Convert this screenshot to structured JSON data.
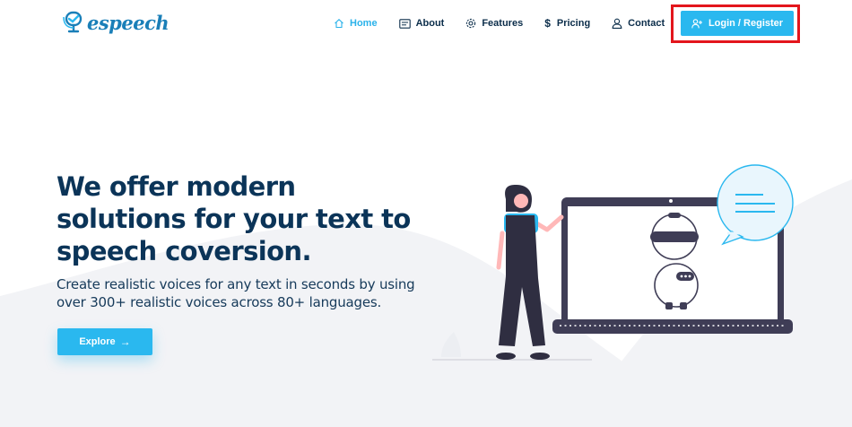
{
  "brand": {
    "name": "espeech"
  },
  "nav": {
    "items": [
      {
        "label": "Home",
        "icon": "home-icon",
        "active": true
      },
      {
        "label": "About",
        "icon": "about-card-icon"
      },
      {
        "label": "Features",
        "icon": "gear-icon"
      },
      {
        "label": "Pricing",
        "icon": "dollar-icon"
      },
      {
        "label": "Contact",
        "icon": "user-icon"
      }
    ],
    "login_label": "Login / Register"
  },
  "hero": {
    "title": "We offer modern solutions for your text to speech coversion.",
    "subtitle": "Create realistic voices for any text in seconds by using over 300+ realistic voices across 80+ languages.",
    "cta_label": "Explore",
    "cta_icon": "arrow-right-icon"
  },
  "colors": {
    "accent": "#2ab8ef",
    "heading": "#0b3458",
    "brand": "#1a7fb8",
    "highlight_border": "#e3161c",
    "illustration_dark": "#3f3d56"
  }
}
